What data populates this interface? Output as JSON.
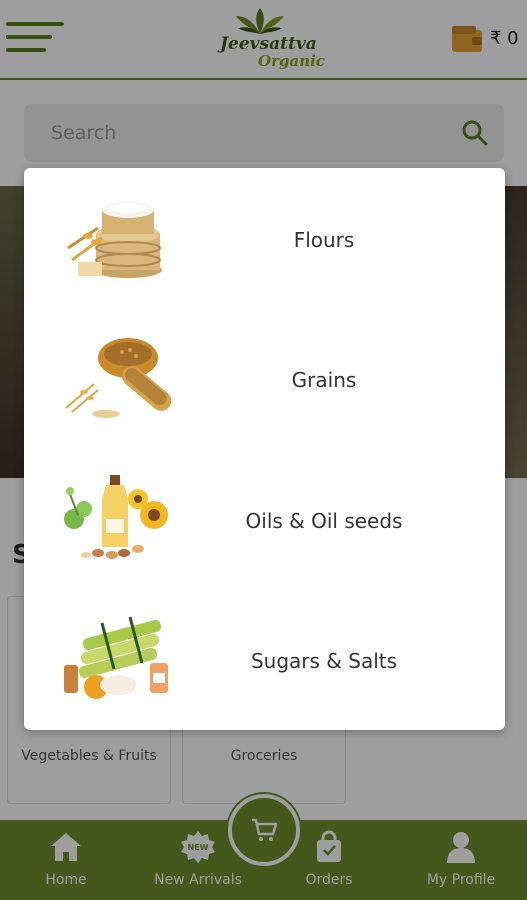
{
  "header": {
    "brand_name": "Jeevsattva",
    "brand_sub": "Organic",
    "wallet_amount": "₹ 0"
  },
  "search": {
    "placeholder": "Search"
  },
  "section": {
    "title": "S"
  },
  "categories_bg": [
    {
      "label": "Vegetables & Fruits"
    },
    {
      "label": "Groceries"
    }
  ],
  "modal": {
    "items": [
      {
        "label": "Flours",
        "icon": "flour-icon"
      },
      {
        "label": "Grains",
        "icon": "grains-icon"
      },
      {
        "label": "Oils & Oil seeds",
        "icon": "oils-icon"
      },
      {
        "label": "Sugars & Salts",
        "icon": "sugar-icon"
      }
    ]
  },
  "bottom_nav": {
    "items": [
      {
        "label": "Home",
        "icon": "home-icon"
      },
      {
        "label": "New Arrivals",
        "icon": "new-badge-icon"
      },
      {
        "label": "Orders",
        "icon": "bag-icon"
      },
      {
        "label": "My Profile",
        "icon": "profile-icon"
      }
    ],
    "cart_icon": "cart-icon"
  },
  "colors": {
    "brand_green": "#6e8e2c",
    "overlay": "rgba(0,0,0,0.38)"
  }
}
